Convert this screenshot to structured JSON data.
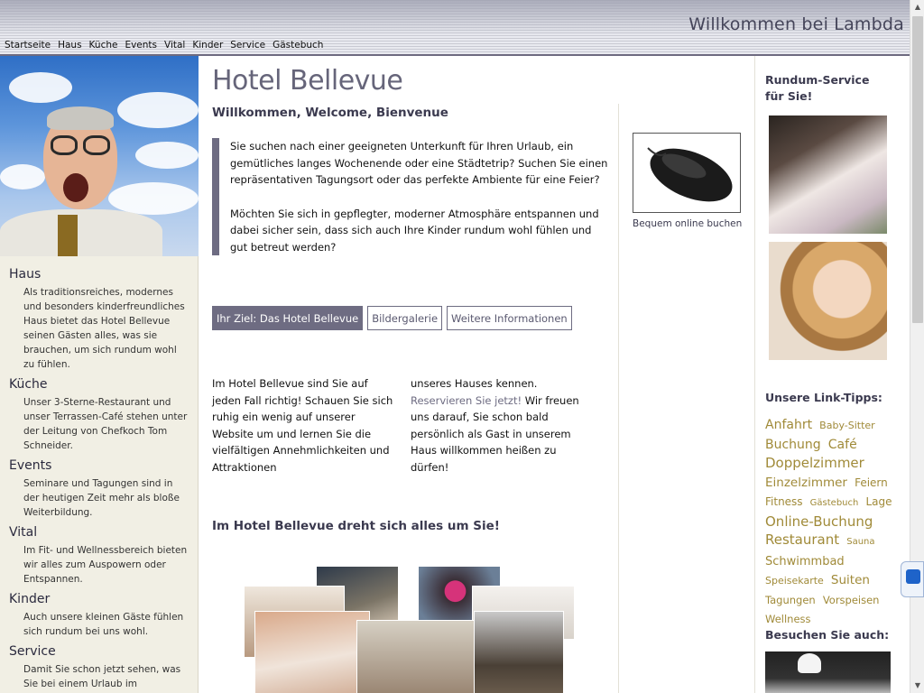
{
  "header": {
    "site_title": "Willkommen bei Lambda",
    "nav": [
      "Startseite",
      "Haus",
      "Küche",
      "Events",
      "Vital",
      "Kinder",
      "Service",
      "Gästebuch"
    ]
  },
  "sidebar": {
    "sections": [
      {
        "title": "Haus",
        "text": "Als traditionsreiches, modernes und besonders kinderfreundliches Haus bietet das Hotel Bellevue seinen Gästen alles, was sie brauchen, um sich rundum wohl zu fühlen."
      },
      {
        "title": "Küche",
        "text": "Unser 3-Sterne-Restaurant und unser Terrassen-Café stehen unter der Leitung von Chefkoch Tom Schneider."
      },
      {
        "title": "Events",
        "text": "Seminare und Tagungen sind in der heutigen Zeit mehr als bloße Weiterbildung."
      },
      {
        "title": "Vital",
        "text": "Im Fit- und Wellnessbereich bieten wir alles zum Auspowern oder Entspannen."
      },
      {
        "title": "Kinder",
        "text": "Auch unsere kleinen Gäste fühlen sich rundum bei uns wohl."
      },
      {
        "title": "Service",
        "text": "Damit Sie schon jetzt sehen, was Sie bei einem Urlaub im Musterstädter Land alles erwarten können, haben"
      }
    ]
  },
  "main": {
    "title": "Hotel Bellevue",
    "subtitle": "Willkommen, Welcome, Bienvenue",
    "intro_p1": "Sie suchen nach einer geeigneten Unterkunft für Ihren Urlaub, ein gemütliches langes Wochenende oder eine Städtetrip? Suchen Sie einen repräsentativen Tagungsort oder das perfekte Ambiente für eine Feier?",
    "intro_p2": "Möchten Sie sich in gepflegter, moderner Atmosphäre entspannen und dabei sicher sein, dass sich auch Ihre Kinder rundum wohl fühlen und gut betreut werden?",
    "tabs": [
      "Ihr Ziel: Das Hotel Bellevue",
      "Bildergalerie",
      "Weitere Informationen"
    ],
    "col1": "Im Hotel Bellevue sind Sie auf jeden Fall richtig! Schauen Sie sich ruhig ein wenig auf unserer Website um und lernen Sie die vielfältigen Annehmlichkeiten und Attraktionen",
    "col2_pre": "unseres Hauses kennen. ",
    "col2_link": "Reservieren Sie jetzt!",
    "col2_post": " Wir freuen uns darauf, Sie schon bald persönlich als Gast in unserem Haus willkommen heißen zu dürfen!",
    "heading2": "Im Hotel Bellevue dreht sich alles um Sie!"
  },
  "ad": {
    "caption": "Bequem online buchen",
    "icon": "mouse-image"
  },
  "right": {
    "service_heading": "Rundum-Service für Sie!",
    "links_heading": "Unsere Link-Tipps:",
    "tags": [
      {
        "label": "Anfahrt",
        "size": 14
      },
      {
        "label": "Baby-Sitter",
        "size": 11
      },
      {
        "label": "Buchung",
        "size": 14
      },
      {
        "label": "Café",
        "size": 14
      },
      {
        "label": "Doppelzimmer",
        "size": 15
      },
      {
        "label": "Einzelzimmer",
        "size": 13.5
      },
      {
        "label": "Feiern",
        "size": 12
      },
      {
        "label": "Fitness",
        "size": 12
      },
      {
        "label": "Gästebuch",
        "size": 10
      },
      {
        "label": "Lage",
        "size": 12
      },
      {
        "label": "Online-Buchung",
        "size": 15
      },
      {
        "label": "Restaurant",
        "size": 15
      },
      {
        "label": "Sauna",
        "size": 10
      },
      {
        "label": "Schwimmbad",
        "size": 13
      },
      {
        "label": "Speisekarte",
        "size": 11
      },
      {
        "label": "Suiten",
        "size": 13.5
      },
      {
        "label": "Tagungen",
        "size": 11.5
      },
      {
        "label": "Vorspeisen",
        "size": 11.5
      },
      {
        "label": "Wellness",
        "size": 11.5
      }
    ],
    "visit_heading": "Besuchen Sie auch:"
  },
  "colors": {
    "accent": "#6e6c82",
    "tag": "#a08a38",
    "sidebar_bg": "#f1efe4"
  }
}
